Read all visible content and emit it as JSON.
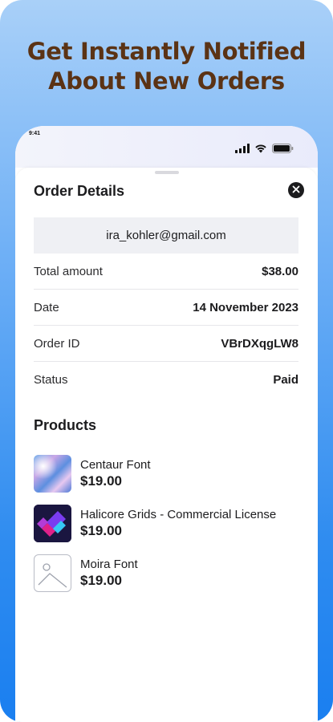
{
  "headline": {
    "line1": "Get Instantly Notified",
    "line2": "About New Orders"
  },
  "status_bar": {
    "time": "9:41",
    "icons": [
      "signal-icon",
      "wifi-icon",
      "battery-icon"
    ]
  },
  "order": {
    "title": "Order Details",
    "close_icon": "close-icon",
    "email": "ira_kohler@gmail.com",
    "rows": [
      {
        "label": "Total amount",
        "value": "$38.00"
      },
      {
        "label": "Date",
        "value": "14 November 2023"
      },
      {
        "label": "Order ID",
        "value": "VBrDXqgLW8"
      },
      {
        "label": "Status",
        "value": "Paid"
      }
    ]
  },
  "products": {
    "title": "Products",
    "items": [
      {
        "name": "Centaur Font",
        "price": "$19.00"
      },
      {
        "name": "Halicore Grids - Commercial License",
        "price": "$19.00"
      },
      {
        "name": "Moira Font",
        "price": "$19.00"
      }
    ]
  },
  "colors": {
    "headline": "#5b3315",
    "background_top": "#a9d0f8",
    "background_bottom": "#1a7ff0"
  }
}
